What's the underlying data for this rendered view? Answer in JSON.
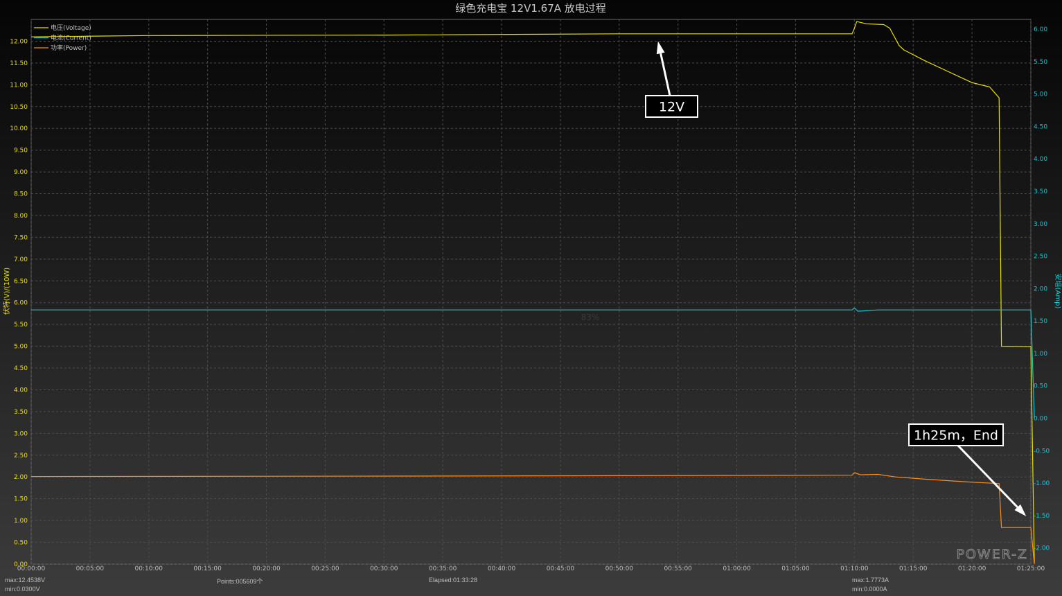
{
  "chart_data": {
    "type": "line",
    "title": "绿色充电宝 12V1.67A 放电过程",
    "ylabel_left": "伏特(V)/(10W)",
    "ylabel_right": "安培(Amp)",
    "ylim_left": [
      0,
      12.5
    ],
    "ylim_right": [
      -2.25,
      6.15
    ],
    "y_ticks_left": [
      "0.00",
      "0.50",
      "1.00",
      "1.50",
      "2.00",
      "2.50",
      "3.00",
      "3.50",
      "4.00",
      "4.50",
      "5.00",
      "5.50",
      "6.00",
      "6.50",
      "7.00",
      "7.50",
      "8.00",
      "8.50",
      "9.00",
      "9.50",
      "10.00",
      "10.50",
      "11.00",
      "11.50",
      "12.00"
    ],
    "y_ticks_right": [
      "-2.00",
      "-1.50",
      "-1.00",
      "-0.50",
      "0.00",
      "0.50",
      "1.00",
      "1.50",
      "2.00",
      "2.50",
      "3.00",
      "3.50",
      "4.00",
      "4.50",
      "5.00",
      "5.50",
      "6.00"
    ],
    "x_ticks": [
      "00:00:00",
      "00:05:00",
      "00:10:00",
      "00:15:00",
      "00:20:00",
      "00:25:00",
      "00:30:00",
      "00:35:00",
      "00:40:00",
      "00:45:00",
      "00:50:00",
      "00:55:00",
      "01:00:00",
      "01:05:00",
      "01:10:00",
      "01:15:00",
      "01:20:00",
      "01:25:00"
    ],
    "xlim_minutes": [
      0,
      85
    ],
    "grid": true,
    "legend_position": "top-left",
    "series": [
      {
        "name": "电压(Voltage)",
        "axis": "left",
        "color": "#e8e000",
        "x_minutes": [
          0,
          10,
          30,
          50,
          69.8,
          70.0,
          70.2,
          71,
          72.5,
          73,
          73.8,
          74.2,
          76,
          78,
          80,
          81.5,
          82.3,
          82.5,
          85,
          85.3
        ],
        "values": [
          12.1,
          12.13,
          12.14,
          12.17,
          12.17,
          12.3,
          12.45,
          12.4,
          12.38,
          12.3,
          11.9,
          11.8,
          11.55,
          11.3,
          11.05,
          10.95,
          10.7,
          5.0,
          4.99,
          0.03
        ]
      },
      {
        "name": "电流(Current)",
        "axis": "right",
        "color": "#18c8d0",
        "x_minutes": [
          0,
          30,
          60,
          69.8,
          70.0,
          70.3,
          72,
          80,
          82.3,
          82.5,
          85,
          85.3
        ],
        "values": [
          1.67,
          1.67,
          1.67,
          1.67,
          1.7,
          1.65,
          1.67,
          1.67,
          1.67,
          1.67,
          1.67,
          0.0
        ]
      },
      {
        "name": "功率(Power)",
        "axis": "left",
        "color": "#ff8c1a",
        "x_minutes": [
          0,
          30,
          69.8,
          70.0,
          70.5,
          72,
          73.5,
          76,
          80,
          82.3,
          82.5,
          85,
          85.3
        ],
        "values": [
          2.01,
          2.02,
          2.04,
          2.1,
          2.05,
          2.06,
          2.0,
          1.95,
          1.88,
          1.85,
          0.84,
          0.84,
          0.0
        ]
      }
    ],
    "annotations": [
      {
        "text": "12V",
        "target_minutes": 53.3,
        "target_value": 12.0
      },
      {
        "text": "1h25m，End",
        "target_minutes": 84.6,
        "target_value": 1.1
      }
    ],
    "watermark": "83%",
    "logo": "POWER-Z"
  },
  "footer": {
    "left_max": "max:12.4538V",
    "left_min": "min:0.0300V",
    "points": "Points:005609个",
    "elapsed": "Elapsed:01:33:28",
    "right_max": "max:1.7773A",
    "right_min": "min:0.0000A"
  },
  "colors": {
    "background": "#1a1a1a",
    "grid": "#4d4d4d",
    "axis_left": "#e8e000",
    "axis_right": "#18c8d0",
    "title": "#c8c8c8"
  }
}
